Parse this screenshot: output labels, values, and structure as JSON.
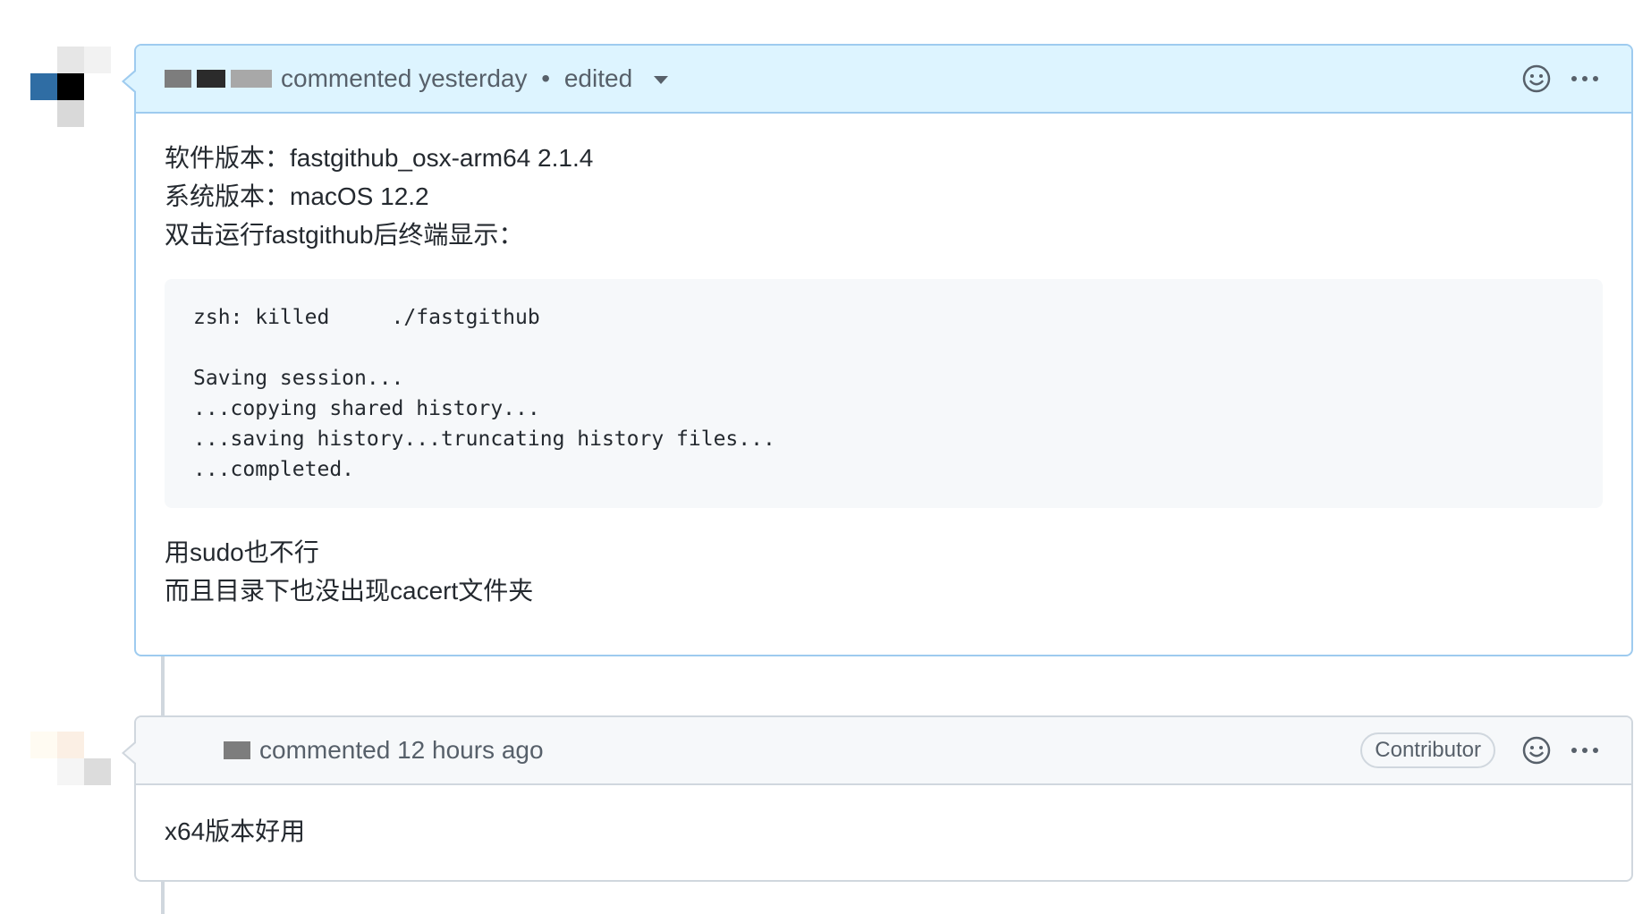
{
  "comments": [
    {
      "author_redacted": true,
      "action": "commented",
      "time": "yesterday",
      "separator": "•",
      "edited_label": "edited",
      "icons": {
        "reaction": "smiley-icon",
        "menu": "kebab-horizontal-icon"
      },
      "body_lines_before": [
        "软件版本：fastgithub_osx-arm64 2.1.4",
        "系统版本：macOS 12.2",
        "双击运行fastgithub后终端显示："
      ],
      "code_lines": [
        "zsh: killed     ./fastgithub",
        "",
        "Saving session...",
        "...copying shared history...",
        "...saving history...truncating history files...",
        "...completed."
      ],
      "body_lines_after": [
        "用sudo也不行",
        "而且目录下也没出现cacert文件夹"
      ]
    },
    {
      "author_redacted": true,
      "action": "commented",
      "time": "12 hours ago",
      "badge": "Contributor",
      "icons": {
        "reaction": "smiley-icon",
        "menu": "kebab-horizontal-icon"
      },
      "body_lines": [
        "x64版本好用"
      ]
    }
  ],
  "colors": {
    "highlight_header_bg": "#ddf4ff",
    "highlight_border": "#9ecbef",
    "default_header_bg": "#f6f8fa",
    "default_border": "#d0d7de",
    "code_bg": "#f6f8fa"
  }
}
